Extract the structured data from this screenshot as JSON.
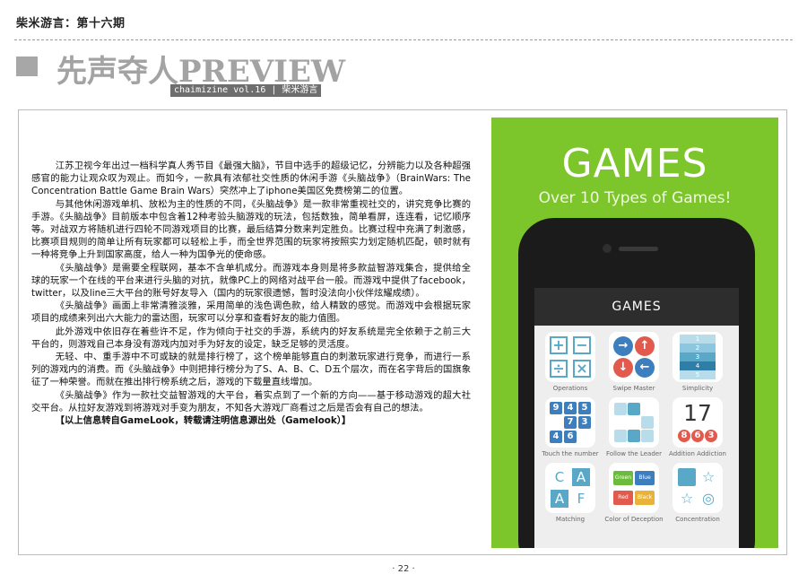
{
  "header": {
    "issue_label": "柴米游言：第十六期",
    "section_title": "先声夺人PREVIEW",
    "sub_banner": "chaimizine vol.16 | 柴米游言"
  },
  "article": {
    "paragraphs": [
      "江苏卫视今年出过一档科学真人秀节目《最强大脑》，节目中选手的超级记忆，分辨能力以及各种超强感官的能力让观众叹为观止。而如今，一款具有浓郁社交性质的休闲手游《头脑战争》（BrainWars: The Concentration Battle Game Brain Wars）突然冲上了iphone美国区免费榜第二的位置。",
      "与其他休闲游戏单机、放松为主的性质的不同，《头脑战争》是一款非常重视社交的，讲究竞争比赛的手游。《头脑战争》目前版本中包含着12种考验头脑游戏的玩法，包括数独，简单看屏，连连看，记忆顺序等。对战双方将随机进行四轮不同游戏项目的比赛，最后结算分数来判定胜负。比赛过程中充满了刺激感，比赛项目规则的简单让所有玩家都可以轻松上手，而全世界范围的玩家将按照实力划定随机匹配，顿时就有一种将竞争上升到国家高度，给人一种为国争光的使命感。",
      "《头脑战争》是需要全程联网，基本不含单机成分。而游戏本身则是将多款益智游戏集合，提供给全球的玩家一个在线的平台来进行头脑的对抗，就像PC上的网络对战平台一般。而游戏中提供了facebook，twitter，以及line三大平台的账号好友导入（国内的玩家很遗憾，暂时没法向小伙伴炫耀成绩）。",
      "《头脑战争》画面上非常清雅淡雅，采用简单的浅色调色款，给人精致的感觉。而游戏中会根据玩家项目的成绩来列出六大能力的雷达图，玩家可以分享和查看好友的能力值图。",
      "此外游戏中依旧存在着些许不足，作为倾向于社交的手游，系统内的好友系统是完全依赖于之前三大平台的，则游戏自己本身没有游戏内加对手为好友的设定，缺乏足够的灵活度。",
      "无轻、中、重手游中不可或缺的就是排行榜了，这个榜单能够直白的刺激玩家进行竞争，而进行一系列的游戏内的消费。而《头脑战争》中则把排行榜分为了S、A、B、C、D五个层次，而在名字背后的国旗象征了一种荣誉。而就在推出排行榜系统之后，游戏的下载量直线增加。",
      "《头脑战争》作为一款社交益智游戏的大平台，着实点到了一个新的方向——基于移动游戏的超大社交平台。从拉好友游戏到将游戏对手变为朋友，不知各大游戏厂商看过之后是否会有自己的想法。"
    ],
    "source_note": "【以上信息转自GameLook，转载请注明信息源出处（Gamelook）】"
  },
  "promo": {
    "heading": "GAMES",
    "subheading": "Over 10 Types of Games!",
    "app_bar_title": "GAMES",
    "tiles": [
      {
        "label": "Operations",
        "glyphs": [
          "+",
          "−",
          "÷",
          "×"
        ]
      },
      {
        "label": "Swipe Master",
        "glyphs": [
          "→",
          "↑",
          "↓",
          "←"
        ]
      },
      {
        "label": "Simplicity",
        "glyphs": [
          "1",
          "2",
          "3",
          "4",
          "5"
        ]
      },
      {
        "label": "Touch the number",
        "glyphs": [
          "9",
          "4",
          "5",
          "7",
          "3",
          "4",
          "6"
        ]
      },
      {
        "label": "Follow the Leader",
        "glyphs": []
      },
      {
        "label": "Addition Addiction",
        "glyphs": [
          "17",
          "8",
          "6",
          "3"
        ]
      },
      {
        "label": "Matching",
        "glyphs": [
          "C",
          "A",
          "A",
          "F"
        ]
      },
      {
        "label": "Color of Deception",
        "glyphs": [
          "Green",
          "Blue",
          "Red",
          "Black"
        ]
      },
      {
        "label": "Concentration",
        "glyphs": [
          "☆",
          "☆",
          "◎"
        ]
      }
    ],
    "colors": {
      "background": "#7cc52a",
      "accent_blue": "#5aa8c8",
      "accent_red": "#e25a4d",
      "phone": "#1b1b1b"
    }
  },
  "footer": {
    "page_number": "· 22 ·"
  }
}
